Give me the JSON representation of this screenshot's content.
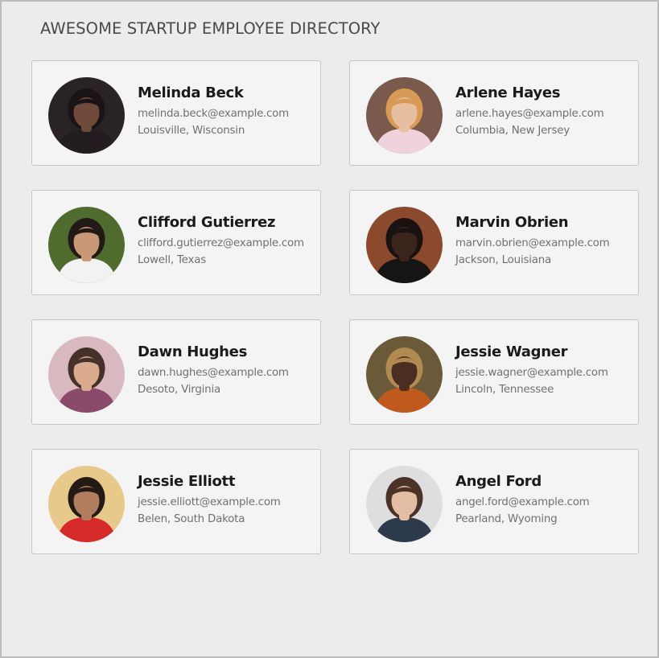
{
  "header": {
    "title": "AWESOME STARTUP EMPLOYEE DIRECTORY"
  },
  "employees": [
    {
      "name": "Melinda Beck",
      "email": "melinda.beck@example.com",
      "location": "Louisville, Wisconsin",
      "avatar": {
        "bg": "#2a2326",
        "skin": "#6e4a3a",
        "hair": "#1b1416",
        "shirt": "#231d21"
      }
    },
    {
      "name": "Arlene Hayes",
      "email": "arlene.hayes@example.com",
      "location": "Columbia, New Jersey",
      "avatar": {
        "bg": "#7a5a4c",
        "skin": "#e6bea0",
        "hair": "#d99a55",
        "shirt": "#f0d2dc"
      }
    },
    {
      "name": "Clifford Gutierrez",
      "email": "clifford.gutierrez@example.com",
      "location": "Lowell, Texas",
      "avatar": {
        "bg": "#4f6b2e",
        "skin": "#c99877",
        "hair": "#221a16",
        "shirt": "#f2f2f2"
      }
    },
    {
      "name": "Marvin Obrien",
      "email": "marvin.obrien@example.com",
      "location": "Jackson, Louisiana",
      "avatar": {
        "bg": "#8b4a2e",
        "skin": "#3b241b",
        "hair": "#1a1210",
        "shirt": "#151515"
      }
    },
    {
      "name": "Dawn Hughes",
      "email": "dawn.hughes@example.com",
      "location": "Desoto, Virginia",
      "avatar": {
        "bg": "#d9b9c0",
        "skin": "#dbab90",
        "hair": "#46302a",
        "shirt": "#8a4a6a"
      }
    },
    {
      "name": "Jessie Wagner",
      "email": "jessie.wagner@example.com",
      "location": "Lincoln, Tennessee",
      "avatar": {
        "bg": "#6a5a3a",
        "skin": "#4a2e22",
        "hair": "#b08a50",
        "shirt": "#c05a1c"
      }
    },
    {
      "name": "Jessie Elliott",
      "email": "jessie.elliott@example.com",
      "location": "Belen, South Dakota",
      "avatar": {
        "bg": "#e8c98c",
        "skin": "#b07e5e",
        "hair": "#241a15",
        "shirt": "#d42a2a"
      }
    },
    {
      "name": "Angel Ford",
      "email": "angel.ford@example.com",
      "location": "Pearland, Wyoming",
      "avatar": {
        "bg": "#dedede",
        "skin": "#e4bda5",
        "hair": "#4a3226",
        "shirt": "#2c3a4c"
      }
    }
  ]
}
